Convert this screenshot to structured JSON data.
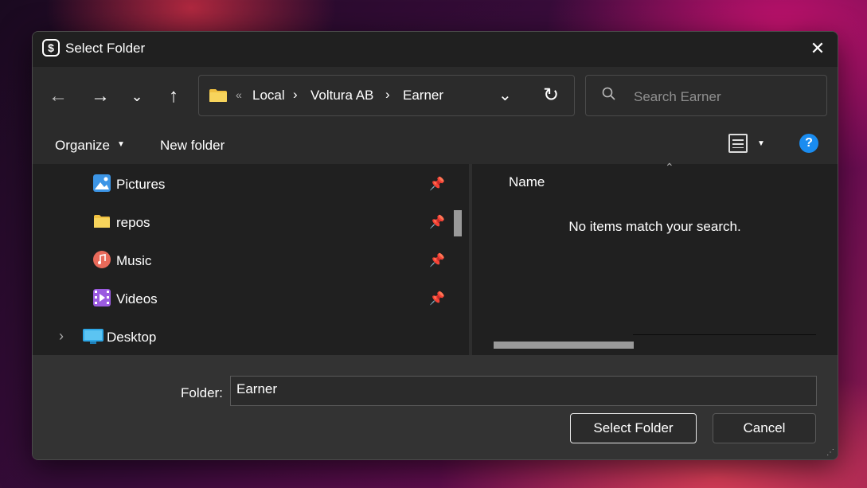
{
  "window": {
    "title": "Select Folder",
    "app_icon_glyph": "$"
  },
  "nav": {
    "back": "←",
    "forward": "→",
    "recent": "⌄",
    "up": "↑"
  },
  "address": {
    "overflow": "«",
    "crumbs": [
      "Local",
      "Voltura AB",
      "Earner"
    ],
    "separator": "›",
    "dropdown": "⌄",
    "refresh": "↻"
  },
  "search": {
    "placeholder": "Search Earner"
  },
  "toolbar": {
    "organize": "Organize",
    "new_folder": "New folder",
    "help": "?"
  },
  "navpane": {
    "items": [
      {
        "label": "Pictures",
        "icon": "pictures-icon",
        "pinned": true,
        "color": "#3c95e6"
      },
      {
        "label": "repos",
        "icon": "folder-icon",
        "pinned": true,
        "color": "#f0c040"
      },
      {
        "label": "Music",
        "icon": "music-icon",
        "pinned": true,
        "color": "#e96a5a"
      },
      {
        "label": "Videos",
        "icon": "videos-icon",
        "pinned": true,
        "color": "#9b5be0"
      },
      {
        "label": "Desktop",
        "icon": "desktop-icon",
        "pinned": false,
        "color": "#2ea7e6"
      }
    ]
  },
  "content": {
    "column_name": "Name",
    "empty_message": "No items match your search."
  },
  "footer": {
    "folder_label": "Folder:",
    "folder_value": "Earner",
    "select_button": "Select Folder",
    "cancel_button": "Cancel"
  },
  "colors": {
    "accent": "#1a8cf0",
    "dialog_bg": "#202020",
    "bar_bg": "#2b2b2b",
    "footer_bg": "#333333"
  }
}
